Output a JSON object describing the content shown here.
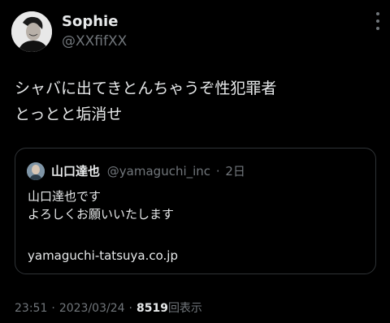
{
  "tweet": {
    "author": {
      "display_name": "Sophie",
      "handle": "@XXfifXX",
      "avatar_icon": "user-avatar"
    },
    "more_icon": "more-vertical-icon",
    "text_lines": [
      "シャバに出てきとんちゃうぞ性犯罪者",
      "とっとと垢消せ"
    ],
    "quoted": {
      "avatar_icon": "user-avatar",
      "display_name": "山口達也",
      "handle": "@yamaguchi_inc",
      "separator": "·",
      "time": "2日",
      "lines": [
        "山口達也です",
        "よろしくお願いいたします"
      ],
      "link": "yamaguchi-tatsuya.co.jp"
    },
    "meta": {
      "time": "23:51",
      "separator": "·",
      "date": "2023/03/24",
      "views": "8519",
      "views_label": "回表示"
    }
  },
  "colors": {
    "background": "#000000",
    "primary_text": "#e7e9ea",
    "secondary_text": "#71767b",
    "border": "#2f3336"
  }
}
